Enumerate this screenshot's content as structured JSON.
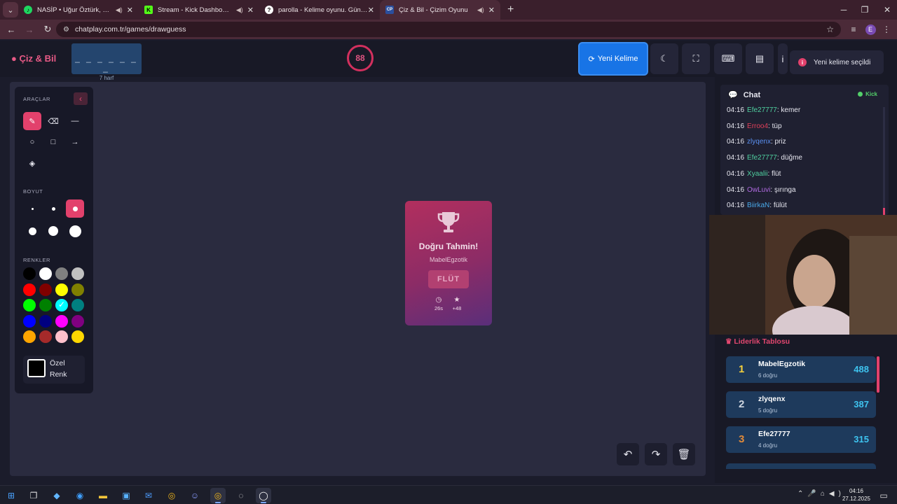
{
  "browser": {
    "tabs": [
      {
        "title": "NASİP • Uğur Öztürk, Stap",
        "icon": "spotify-icon",
        "audio": true,
        "active": false
      },
      {
        "title": "Stream - Kick Dashboard",
        "icon": "kick-icon",
        "audio": true,
        "active": false
      },
      {
        "title": "parolla - Kelime oyunu. Günlük",
        "icon": "parolla-icon",
        "audio": false,
        "active": false
      },
      {
        "title": "Çiz & Bil - Çizim Oyunu",
        "icon": "chatplay-icon",
        "audio": true,
        "active": true
      }
    ],
    "url": "chatplay.com.tr/games/drawguess",
    "profile_initial": "E"
  },
  "header": {
    "logo": "Çiz & Bil",
    "word_mask": "_ _ _ _ _ _ _",
    "word_length": "7 harf",
    "timer": "88",
    "new_word_label": "Yeni Kelime",
    "toast": "Yeni kelime seçildi"
  },
  "tools": {
    "section_tools": "ARAÇLAR",
    "section_size": "BOYUT",
    "section_colors": "RENKLER",
    "custom_color_label": "Özel Renk",
    "colors": [
      "#000000",
      "#ffffff",
      "#808080",
      "#c0c0c0",
      "#ff0000",
      "#800000",
      "#ffff00",
      "#808000",
      "#00ff00",
      "#008000",
      "#00ffff",
      "#008080",
      "#0000ff",
      "#000080",
      "#ff00ff",
      "#800080",
      "#ffa500",
      "#a52a2a",
      "#ffc0cb",
      "#ffd700"
    ],
    "selected_color": "#00ffff",
    "selected_size_index": 2
  },
  "result": {
    "title": "Doğru Tahmin!",
    "user": "MabelEgzotik",
    "word": "FLÜT",
    "time": "26s",
    "points": "+48"
  },
  "chat": {
    "title": "Chat",
    "platform": "Kick",
    "messages": [
      {
        "time": "04:16",
        "user": "Efe27777",
        "text": ": kemer",
        "color": "#4fd0a0"
      },
      {
        "time": "04:16",
        "user": "Erroo4",
        "text": ": tüp",
        "color": "#e0405a"
      },
      {
        "time": "04:16",
        "user": "zlyqenx",
        "text": ": priz",
        "color": "#5a8ff0"
      },
      {
        "time": "04:16",
        "user": "Efe27777",
        "text": ": düğme",
        "color": "#4fd0a0"
      },
      {
        "time": "04:16",
        "user": "Xyaalii",
        "text": ": flüt",
        "color": "#4fd0a0"
      },
      {
        "time": "04:16",
        "user": "OwLuvi",
        "text": ": şırınga",
        "color": "#b06ae0"
      },
      {
        "time": "04:16",
        "user": "BiirkaN",
        "text": ": fülüt",
        "color": "#4aa8e8"
      }
    ]
  },
  "leaderboard": {
    "title": "Liderlik Tablosu",
    "rows": [
      {
        "rank": "1",
        "name": "MabelEgzotik",
        "count": "6 doğru",
        "score": "488",
        "rank_color": "#f5d03c"
      },
      {
        "rank": "2",
        "name": "zlyqenx",
        "count": "5 doğru",
        "score": "387",
        "rank_color": "#cfd6e0"
      },
      {
        "rank": "3",
        "name": "Efe27777",
        "count": "4 doğru",
        "score": "315",
        "rank_color": "#e08a3a"
      }
    ]
  },
  "taskbar": {
    "time": "04:16",
    "date": "27.12.2025"
  }
}
